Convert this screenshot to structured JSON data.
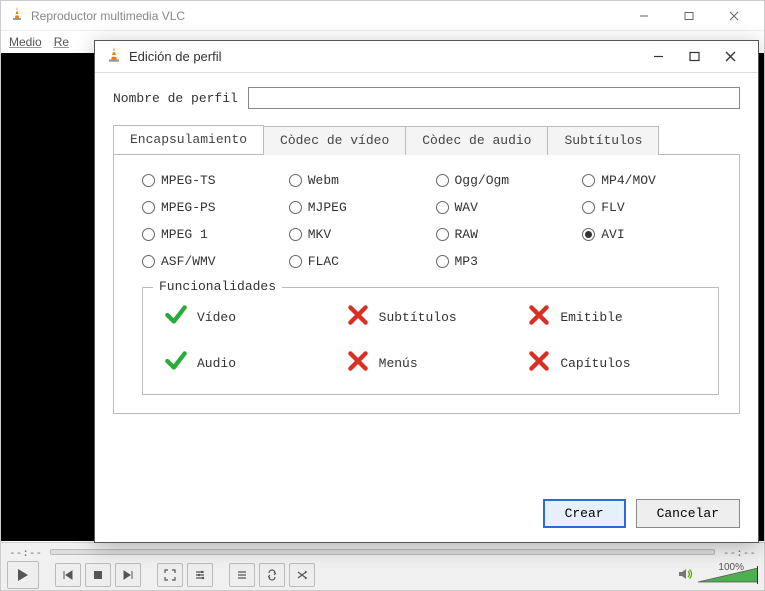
{
  "main": {
    "title": "Reproductor multimedia VLC",
    "menu": [
      "Medio",
      "Re"
    ],
    "time_left": "--:--",
    "time_right": "--:--",
    "volume_label": "100%"
  },
  "dialog": {
    "title": "Edición de perfil",
    "profile_label": "Nombre de perfil",
    "profile_value": "",
    "tabs": [
      "Encapsulamiento",
      "Còdec de vídeo",
      "Còdec de audio",
      "Subtítulos"
    ],
    "radios": [
      {
        "label": "MPEG-TS",
        "selected": false
      },
      {
        "label": "Webm",
        "selected": false
      },
      {
        "label": "Ogg/Ogm",
        "selected": false
      },
      {
        "label": "MP4/MOV",
        "selected": false
      },
      {
        "label": "MPEG-PS",
        "selected": false
      },
      {
        "label": "MJPEG",
        "selected": false
      },
      {
        "label": "WAV",
        "selected": false
      },
      {
        "label": "FLV",
        "selected": false
      },
      {
        "label": "MPEG 1",
        "selected": false
      },
      {
        "label": "MKV",
        "selected": false
      },
      {
        "label": "RAW",
        "selected": false
      },
      {
        "label": "AVI",
        "selected": true
      },
      {
        "label": "ASF/WMV",
        "selected": false
      },
      {
        "label": "FLAC",
        "selected": false
      },
      {
        "label": "MP3",
        "selected": false
      }
    ],
    "features_label": "Funcionalidades",
    "features": [
      {
        "label": "Vídeo",
        "ok": true
      },
      {
        "label": "Subtítulos",
        "ok": false
      },
      {
        "label": "Emitible",
        "ok": false
      },
      {
        "label": "Audio",
        "ok": true
      },
      {
        "label": "Menús",
        "ok": false
      },
      {
        "label": "Capítulos",
        "ok": false
      }
    ],
    "btn_primary": "Crear",
    "btn_cancel": "Cancelar"
  }
}
